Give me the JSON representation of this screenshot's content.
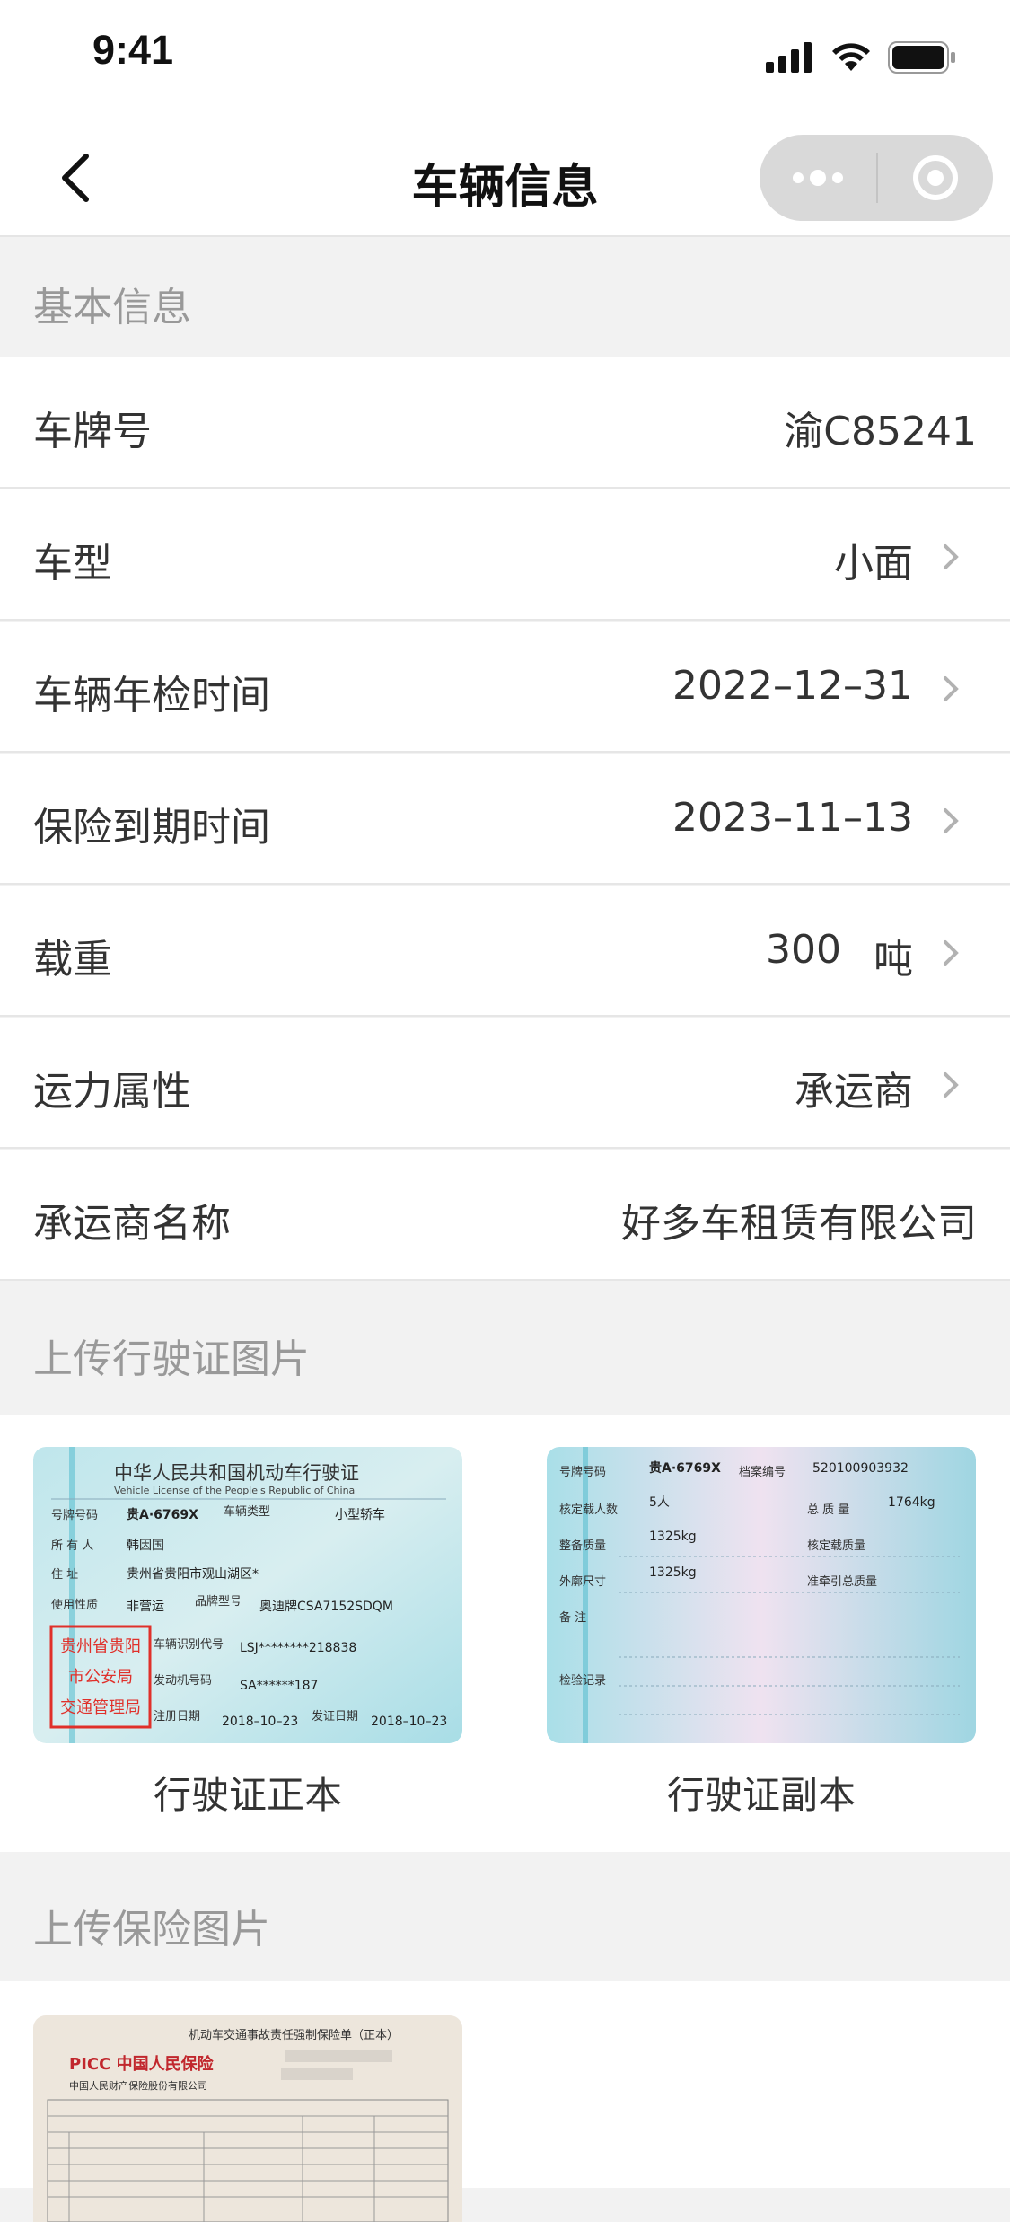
{
  "status": {
    "time": "9:41"
  },
  "nav": {
    "title": "车辆信息"
  },
  "basic": {
    "title": "基本信息",
    "rows": [
      {
        "label": "车牌号",
        "value": "渝C85241"
      },
      {
        "label": "车型",
        "value": "小面"
      },
      {
        "label": "车辆年检时间",
        "value": "2022–12–31"
      },
      {
        "label": "保险到期时间",
        "value": "2023–11–13"
      },
      {
        "label": "载重",
        "value": "300",
        "unit": "吨"
      },
      {
        "label": "运力属性",
        "value": "承运商"
      },
      {
        "label": "承运商名称",
        "value": "好多车租赁有限公司"
      }
    ]
  },
  "license": {
    "title": "上传行驶证图片",
    "front_caption": "行驶证正本",
    "back_caption": "行驶证副本",
    "front": {
      "title_cn": "中华人民共和国机动车行驶证",
      "title_en": "Vehicle License of the People's Republic of China",
      "plate_label": "号牌号码",
      "plate": "贵A·6769X",
      "type_label": "车辆类型",
      "type": "小型轿车",
      "owner_label": "所 有 人",
      "owner": "韩因国",
      "address_label": "住  址",
      "address": "贵州省贵阳市观山湖区*",
      "use_label": "使用性质",
      "use": "非营运",
      "model_label": "品牌型号",
      "model": "奥迪牌CSA7152SDQM",
      "vin_label": "车辆识别代号",
      "vin": "LSJ********218838",
      "engine_label": "发动机号码",
      "engine": "SA******187",
      "reg_label": "注册日期",
      "reg": "2018–10–23",
      "issue_label": "发证日期",
      "issue": "2018–10–23",
      "stamp": [
        "贵州省贵阳",
        "市公安局",
        "交通管理局"
      ]
    },
    "back": {
      "plate_label": "号牌号码",
      "plate": "贵A·6769X",
      "file_label": "档案编号",
      "file": "520100903932",
      "seats_label": "核定载人数",
      "seats": "5人",
      "total_label": "总 质 量",
      "total": "1764kg",
      "curb_label": "整备质量",
      "curb": "1325kg",
      "load_label": "核定载质量",
      "size_label": "外廓尺寸",
      "size": "1325kg",
      "tow_label": "准牵引总质量",
      "note_label": "备  注",
      "inspect_label": "检验记录"
    }
  },
  "insurance": {
    "title": "上传保险图片",
    "doc_title": "机动车交通事故责任强制保险单（正本）",
    "brand": "PICC 中国人民保险",
    "company": "中国人民财产保险股份有限公司"
  }
}
